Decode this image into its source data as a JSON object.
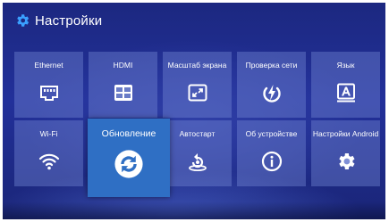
{
  "header": {
    "title": "Настройки",
    "icon": "gear-icon"
  },
  "tiles": [
    {
      "label": "Ethernet",
      "icon": "ethernet-port-icon"
    },
    {
      "label": "HDMI",
      "icon": "hdmi-display-icon"
    },
    {
      "label": "Масштаб экрана",
      "icon": "screen-scale-icon"
    },
    {
      "label": "Проверка сети",
      "icon": "network-check-icon"
    },
    {
      "label": "Язык",
      "icon": "language-icon"
    },
    {
      "label": "Wi-Fi",
      "icon": "wifi-icon"
    },
    {
      "label": "Обновление",
      "icon": "refresh-icon",
      "active": true
    },
    {
      "label": "Автостарт",
      "icon": "autostart-icon"
    },
    {
      "label": "Об устройстве",
      "icon": "info-icon"
    },
    {
      "label": "Настройки Android",
      "icon": "gear-icon"
    }
  ],
  "colors": {
    "background": "#22309a",
    "tile": "#7f8fd6",
    "active_tile": "#2f6fc4",
    "text": "#ffffff"
  }
}
